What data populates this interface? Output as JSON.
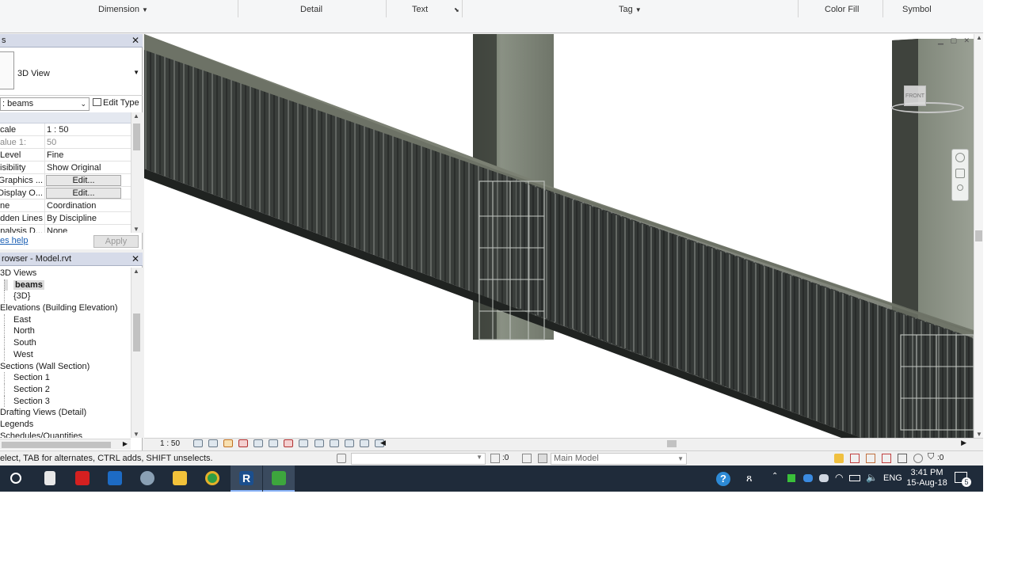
{
  "ribbon": {
    "panels": [
      {
        "label": "Dimension",
        "dropdown": true
      },
      {
        "label": "Detail",
        "dropdown": false
      },
      {
        "label": "Text",
        "dropdown": false,
        "launcher": true
      },
      {
        "label": "Tag",
        "dropdown": true
      },
      {
        "label": "Color Fill",
        "dropdown": false
      },
      {
        "label": "Symbol",
        "dropdown": false
      }
    ]
  },
  "properties": {
    "title": "s",
    "type_name": "3D View",
    "instance_selector": ": beams",
    "edit_type_label": "Edit Type",
    "rows": [
      {
        "key": "cale",
        "value": "1 : 50",
        "kind": "text"
      },
      {
        "key": "alue    1:",
        "value": "50",
        "kind": "gray"
      },
      {
        "key": "Level",
        "value": "Fine",
        "kind": "text"
      },
      {
        "key": "isibility",
        "value": "Show Original",
        "kind": "text"
      },
      {
        "key": "y/Graphics ...",
        "value": "Edit...",
        "kind": "button"
      },
      {
        "key": ": Display O...",
        "value": "Edit...",
        "kind": "button"
      },
      {
        "key": "ne",
        "value": "Coordination",
        "kind": "text"
      },
      {
        "key": "Hidden Lines",
        "value": "By Discipline",
        "kind": "text"
      },
      {
        "key": "Analysis D...",
        "value": "None",
        "kind": "text"
      }
    ],
    "help_link": "es help",
    "apply_label": "Apply"
  },
  "project_browser": {
    "title": "rowser - Model.rvt",
    "items": [
      {
        "label": "3D Views",
        "level": 1,
        "selected": false
      },
      {
        "label": "beams",
        "level": 2,
        "selected": true
      },
      {
        "label": "{3D}",
        "level": 2,
        "selected": false
      },
      {
        "label": "Elevations (Building Elevation)",
        "level": 1,
        "selected": false
      },
      {
        "label": "East",
        "level": 2,
        "selected": false
      },
      {
        "label": "North",
        "level": 2,
        "selected": false
      },
      {
        "label": "South",
        "level": 2,
        "selected": false
      },
      {
        "label": "West",
        "level": 2,
        "selected": false
      },
      {
        "label": "Sections (Wall Section)",
        "level": 1,
        "selected": false
      },
      {
        "label": "Section 1",
        "level": 2,
        "selected": false
      },
      {
        "label": "Section 2",
        "level": 2,
        "selected": false
      },
      {
        "label": "Section 3",
        "level": 2,
        "selected": false
      },
      {
        "label": "Drafting Views (Detail)",
        "level": 1,
        "selected": false
      },
      {
        "label": "Legends",
        "level": 1,
        "selected": false
      },
      {
        "label": "Schedules/Quantities",
        "level": 1,
        "selected": false
      }
    ]
  },
  "viewport": {
    "viewcube_label": "FRONT",
    "scale_label": "1 : 50"
  },
  "statusbar": {
    "message": "elect, TAB for alternates, CTRL adds, SHIFT unselects.",
    "sel_count": ":0",
    "model": "Main Model",
    "filter_count": ":0"
  },
  "taskbar": {
    "language": "ENG",
    "time": "3:41 PM",
    "date": "15-Aug-18",
    "notification_count": "5"
  },
  "colors": {
    "ribbon_bg": "#f5f6f7",
    "palette_title": "#d6dbe9",
    "taskbar": "#1f2b3a",
    "concrete": "#6b7064",
    "rebar": "#2a2d2b"
  }
}
